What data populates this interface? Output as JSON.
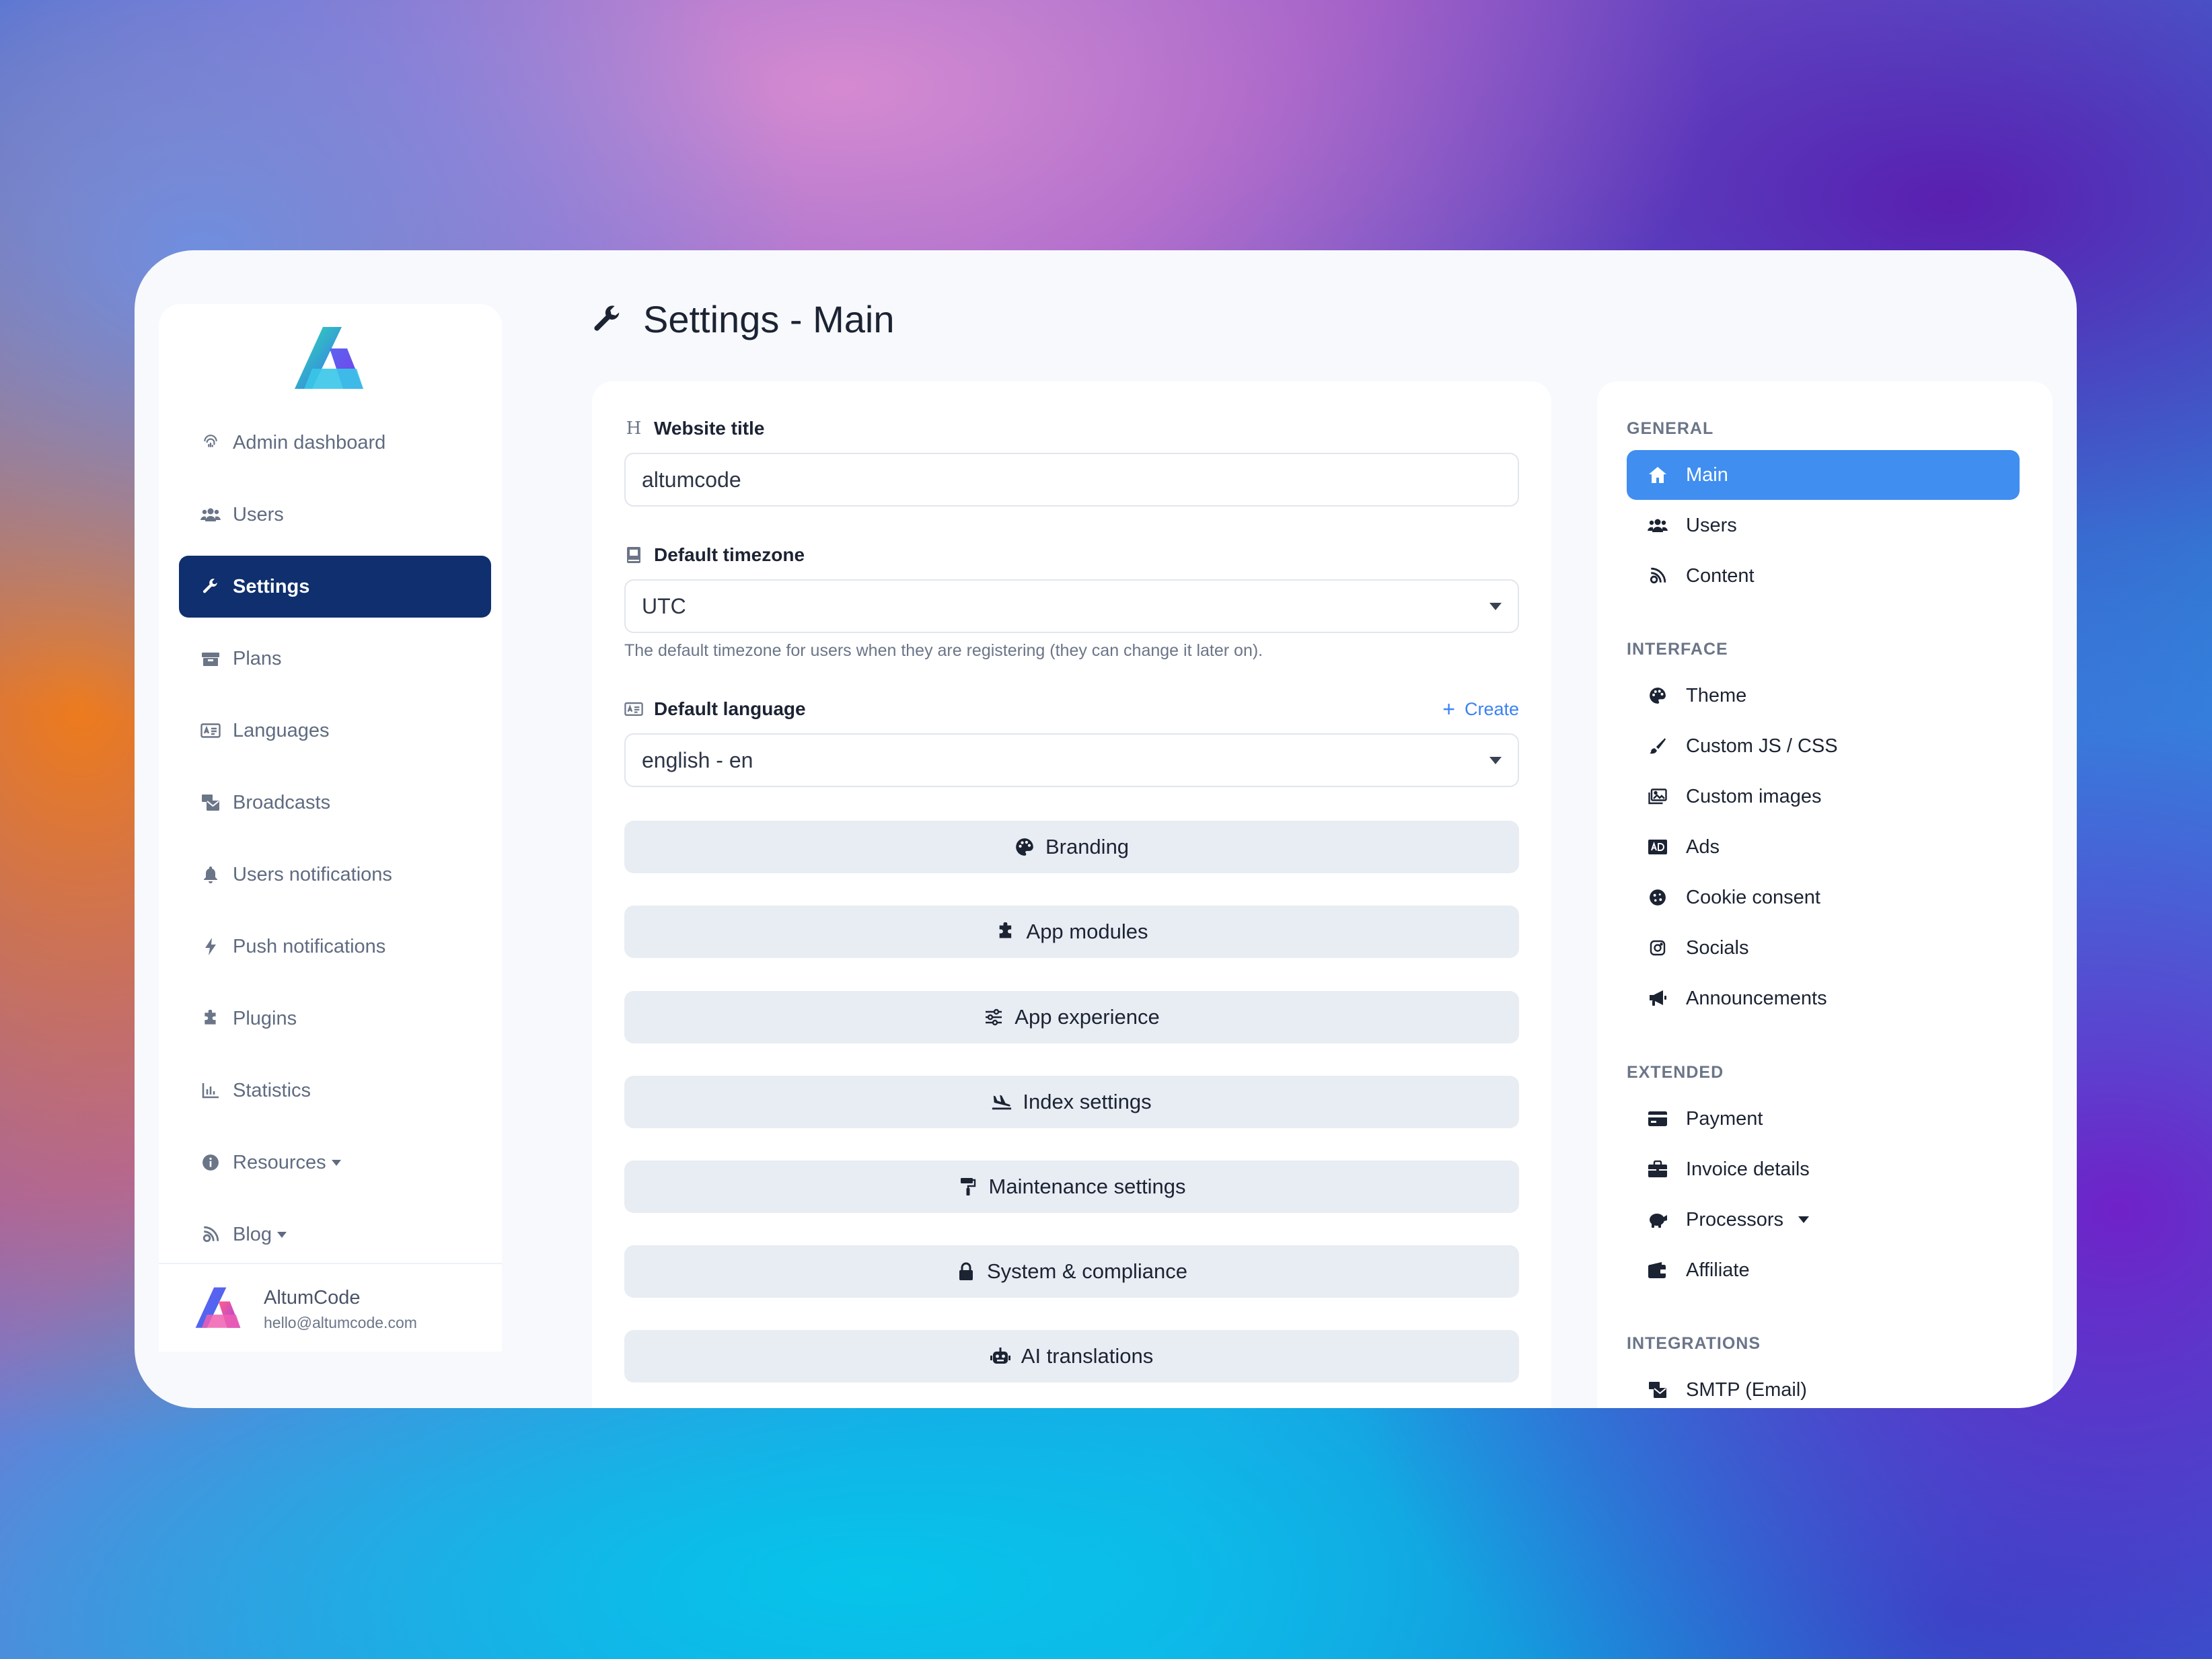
{
  "page": {
    "title": "Settings - Main"
  },
  "sidebar": {
    "items": [
      {
        "label": "Admin dashboard",
        "icon": "fingerprint-icon",
        "active": false
      },
      {
        "label": "Users",
        "icon": "users-icon",
        "active": false
      },
      {
        "label": "Settings",
        "icon": "wrench-icon",
        "active": true
      },
      {
        "label": "Plans",
        "icon": "box-icon",
        "active": false
      },
      {
        "label": "Languages",
        "icon": "language-card-icon",
        "active": false
      },
      {
        "label": "Broadcasts",
        "icon": "mail-bulk-icon",
        "active": false
      },
      {
        "label": "Users notifications",
        "icon": "bell-icon",
        "active": false
      },
      {
        "label": "Push notifications",
        "icon": "bolt-icon",
        "active": false
      },
      {
        "label": "Plugins",
        "icon": "puzzle-icon",
        "active": false
      },
      {
        "label": "Statistics",
        "icon": "chart-icon",
        "active": false
      },
      {
        "label": "Resources",
        "icon": "info-icon",
        "active": false,
        "dropdown": true
      },
      {
        "label": "Blog",
        "icon": "blog-icon",
        "active": false,
        "dropdown": true
      }
    ],
    "user": {
      "name": "AltumCode",
      "email": "hello@altumcode.com"
    }
  },
  "form": {
    "website_title": {
      "label": "Website title",
      "value": "altumcode"
    },
    "default_timezone": {
      "label": "Default timezone",
      "value": "UTC",
      "help": "The default timezone for users when they are registering (they can change it later on)."
    },
    "default_language": {
      "label": "Default language",
      "value": "english - en",
      "create_label": "Create"
    }
  },
  "sections": [
    {
      "label": "Branding",
      "icon": "palette-icon"
    },
    {
      "label": "App modules",
      "icon": "puzzle-icon"
    },
    {
      "label": "App experience",
      "icon": "sliders-icon"
    },
    {
      "label": "Index settings",
      "icon": "plane-landing-icon"
    },
    {
      "label": "Maintenance settings",
      "icon": "paint-roller-icon"
    },
    {
      "label": "System & compliance",
      "icon": "lock-icon"
    },
    {
      "label": "AI translations",
      "icon": "robot-icon"
    }
  ],
  "settings_nav": {
    "general": {
      "heading": "GENERAL",
      "items": [
        {
          "label": "Main",
          "icon": "home-icon",
          "active": true
        },
        {
          "label": "Users",
          "icon": "users-icon"
        },
        {
          "label": "Content",
          "icon": "blog-icon"
        }
      ]
    },
    "interface": {
      "heading": "INTERFACE",
      "items": [
        {
          "label": "Theme",
          "icon": "palette-icon"
        },
        {
          "label": "Custom JS / CSS",
          "icon": "brush-icon"
        },
        {
          "label": "Custom images",
          "icon": "images-icon"
        },
        {
          "label": "Ads",
          "icon": "ad-icon"
        },
        {
          "label": "Cookie consent",
          "icon": "cookie-icon"
        },
        {
          "label": "Socials",
          "icon": "instagram-icon"
        },
        {
          "label": "Announcements",
          "icon": "bullhorn-icon"
        }
      ]
    },
    "extended": {
      "heading": "EXTENDED",
      "items": [
        {
          "label": "Payment",
          "icon": "credit-card-icon"
        },
        {
          "label": "Invoice details",
          "icon": "briefcase-icon"
        },
        {
          "label": "Processors",
          "icon": "piggy-bank-icon",
          "dropdown": true
        },
        {
          "label": "Affiliate",
          "icon": "wallet-icon"
        }
      ]
    },
    "integrations": {
      "heading": "INTEGRATIONS",
      "items": [
        {
          "label": "SMTP (Email)",
          "icon": "mail-bulk-icon"
        }
      ]
    }
  },
  "colors": {
    "sidebar_active_bg": "#0f2f6e",
    "right_active_bg": "#3f8ef0",
    "link": "#3b82f6"
  }
}
